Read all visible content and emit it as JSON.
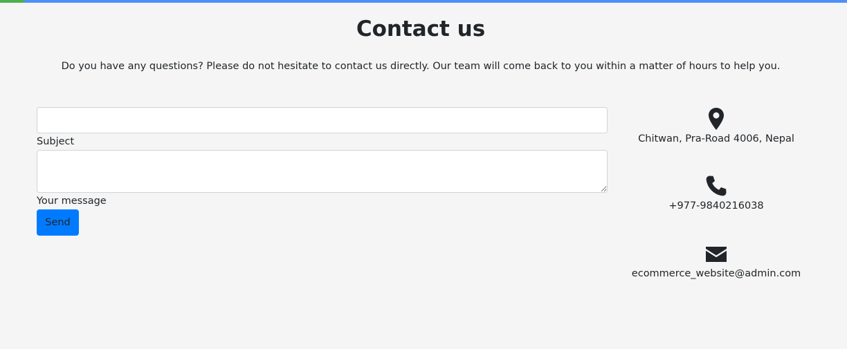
{
  "page": {
    "title": "Contact us",
    "intro": "Do you have any questions? Please do not hesitate to contact us directly. Our team will come back to you within a matter of hours to help you."
  },
  "form": {
    "subject_label": "Subject",
    "subject_value": "",
    "message_label": "Your message",
    "message_value": "",
    "send_label": "Send"
  },
  "contact": {
    "address": "Chitwan, Pra-Road 4006, Nepal",
    "phone": "+977-9840216038",
    "email": "ecommerce_website@admin.com",
    "icons": [
      "map-marker-icon",
      "phone-icon",
      "envelope-icon"
    ]
  },
  "colors": {
    "accent": "#007bff",
    "top_bar": "#4f8ff7",
    "top_bar_progress": "#4caf50",
    "background": "#f5f5f5",
    "text": "#212529"
  }
}
